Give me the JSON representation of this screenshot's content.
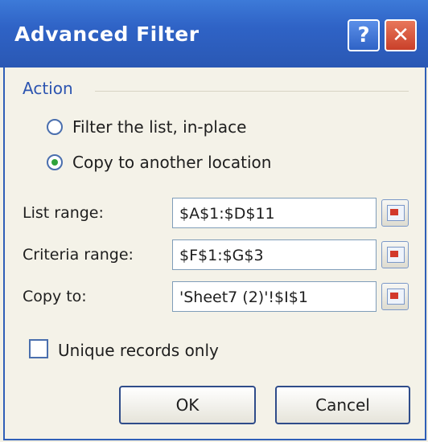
{
  "dialog": {
    "title": "Advanced Filter",
    "help_label": "?",
    "close_label": "✕"
  },
  "action": {
    "group_label": "Action",
    "options": [
      {
        "label": "Filter the list, in-place",
        "selected": false
      },
      {
        "label": "Copy to another location",
        "selected": true
      }
    ]
  },
  "fields": {
    "list_range": {
      "label": "List range:",
      "value": "$A$1:$D$11"
    },
    "criteria_range": {
      "label": "Criteria range:",
      "value": "$F$1:$G$3"
    },
    "copy_to": {
      "label": "Copy to:",
      "value": "'Sheet7 (2)'!$I$1"
    }
  },
  "unique": {
    "label": "Unique records only",
    "checked": false
  },
  "buttons": {
    "ok": "OK",
    "cancel": "Cancel"
  },
  "colors": {
    "titlebar": "#2f63c6",
    "group_label": "#2c54b0",
    "close": "#c9402a"
  }
}
